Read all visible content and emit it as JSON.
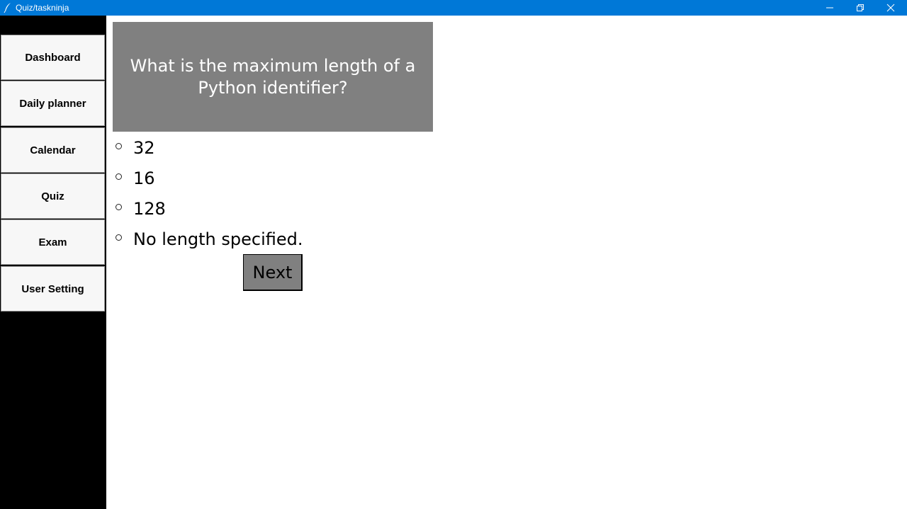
{
  "window": {
    "title": "Quiz/taskninja",
    "icon": "feather-icon",
    "controls": [
      "minimize-icon",
      "restore-icon",
      "close-icon"
    ]
  },
  "sidebar": {
    "items": [
      {
        "label": "Dashboard"
      },
      {
        "label": "Daily planner"
      },
      {
        "label": "Calendar"
      },
      {
        "label": "Quiz"
      },
      {
        "label": "Exam"
      },
      {
        "label": "User Setting"
      }
    ]
  },
  "quiz": {
    "question": "What is the maximum length of a Python identifier?",
    "options": [
      {
        "label": "32"
      },
      {
        "label": "16"
      },
      {
        "label": "128"
      },
      {
        "label": "No length specified."
      }
    ],
    "next_label": "Next"
  },
  "colors": {
    "titlebar": "#0078d7",
    "sidebar_bg": "#000000",
    "question_bg": "#808080",
    "button_bg": "#808080"
  }
}
